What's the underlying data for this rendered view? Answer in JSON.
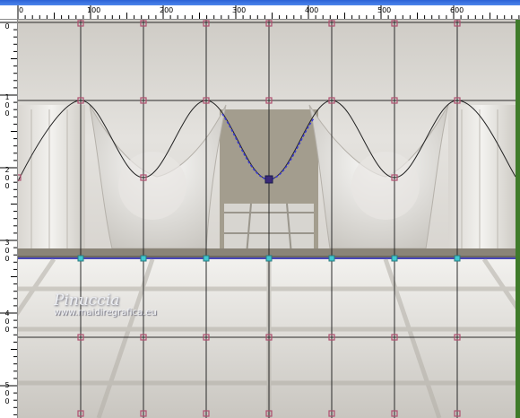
{
  "ruler": {
    "horizontal_labels": [
      "0",
      "100",
      "200",
      "300",
      "400",
      "500",
      "600"
    ],
    "vertical_labels": [
      {
        "digits": [
          "0"
        ]
      },
      {
        "digits": [
          "1",
          "0",
          "0"
        ]
      },
      {
        "digits": [
          "2",
          "0",
          "0"
        ]
      },
      {
        "digits": [
          "3",
          "0",
          "0"
        ]
      },
      {
        "digits": [
          "4",
          "0",
          "0"
        ]
      },
      {
        "digits": [
          "5",
          "0",
          "0"
        ]
      }
    ]
  },
  "watermark": {
    "name": "Pinuccia",
    "site": "www.maidiregrafica.eu"
  },
  "colors": {
    "ruler_bg": "#ffffff",
    "grid_line": "#2a2a2a",
    "curve_line": "#222222",
    "selection_path": "#3b3bd6",
    "node_marker": "#b05070",
    "node_marker_cyan": "#40c8d0",
    "floor_band": "#8a8478"
  }
}
